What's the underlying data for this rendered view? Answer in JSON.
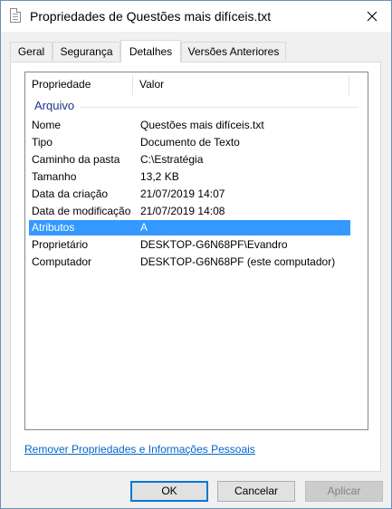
{
  "window": {
    "title": "Propriedades de Questões mais difíceis.txt",
    "file_icon": "text-file-icon",
    "close_icon": "close-icon"
  },
  "tabs": [
    {
      "label": "Geral",
      "active": false
    },
    {
      "label": "Segurança",
      "active": false
    },
    {
      "label": "Detalhes",
      "active": true
    },
    {
      "label": "Versões Anteriores",
      "active": false
    }
  ],
  "details": {
    "columns": {
      "property": "Propriedade",
      "value": "Valor"
    },
    "group": "Arquivo",
    "rows": [
      {
        "property": "Nome",
        "value": "Questões mais difíceis.txt"
      },
      {
        "property": "Tipo",
        "value": "Documento de Texto"
      },
      {
        "property": "Caminho da pasta",
        "value": "C:\\Estratégia"
      },
      {
        "property": "Tamanho",
        "value": "13,2 KB"
      },
      {
        "property": "Data da criação",
        "value": "21/07/2019 14:07"
      },
      {
        "property": "Data de modificação",
        "value": "21/07/2019 14:08"
      },
      {
        "property": "Atributos",
        "value": "A",
        "selected": true
      },
      {
        "property": "Proprietário",
        "value": "DESKTOP-G6N68PF\\Evandro"
      },
      {
        "property": "Computador",
        "value": "DESKTOP-G6N68PF (este computador)"
      }
    ],
    "remove_link": "Remover Propriedades e Informações Pessoais"
  },
  "buttons": {
    "ok": "OK",
    "cancel": "Cancelar",
    "apply": "Aplicar"
  },
  "colors": {
    "selection": "#3399ff",
    "link": "#0066cc",
    "group_label": "#1e3287"
  }
}
